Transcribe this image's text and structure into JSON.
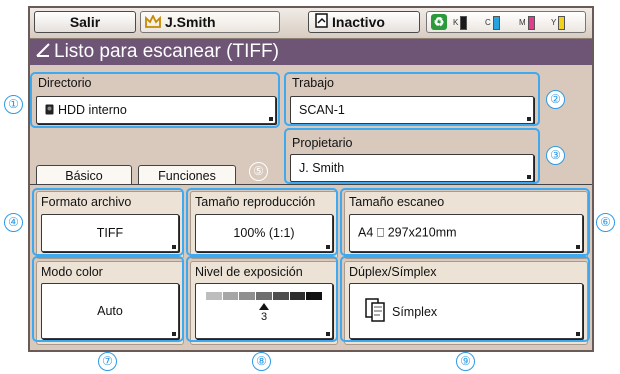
{
  "topbar": {
    "exit_label": "Salir",
    "user_label": "J.Smith",
    "state_label": "Inactivo",
    "inks": [
      {
        "label": "K",
        "color": "#1a1a1a"
      },
      {
        "label": "C",
        "color": "#27a3dd"
      },
      {
        "label": "M",
        "color": "#e23c8c"
      },
      {
        "label": "Y",
        "color": "#f0d21e"
      }
    ]
  },
  "title": "Listo para escanear (TIFF)",
  "fields": {
    "directory": {
      "label": "Directorio",
      "value": "HDD interno",
      "callout": "①"
    },
    "job": {
      "label": "Trabajo",
      "value": "SCAN-1",
      "callout": "②"
    },
    "owner": {
      "label": "Propietario",
      "value": "J. Smith",
      "callout": "③"
    },
    "file_format": {
      "label": "Formato archivo",
      "value": "TIFF",
      "callout": "④"
    },
    "repro_size": {
      "label": "Tamaño reproducción",
      "value": "100% (1:1)",
      "callout": "⑤"
    },
    "scan_size": {
      "label": "Tamaño escaneo",
      "value": "A4 ⎕ 297x210mm",
      "callout": "⑥"
    },
    "color_mode": {
      "label": "Modo color",
      "value": "Auto",
      "callout": "⑦"
    },
    "exposure": {
      "label": "Nivel de exposición",
      "level": "3",
      "callout": "⑧"
    },
    "duplex": {
      "label": "Dúplex/Símplex",
      "value": "Símplex",
      "callout": "⑨"
    }
  },
  "tabs": {
    "basic": "Básico",
    "functions": "Funciones"
  },
  "colors": {
    "title_bar": "#6e5475",
    "highlight": "#3fa9ef",
    "panel": "#d9c9bd"
  }
}
